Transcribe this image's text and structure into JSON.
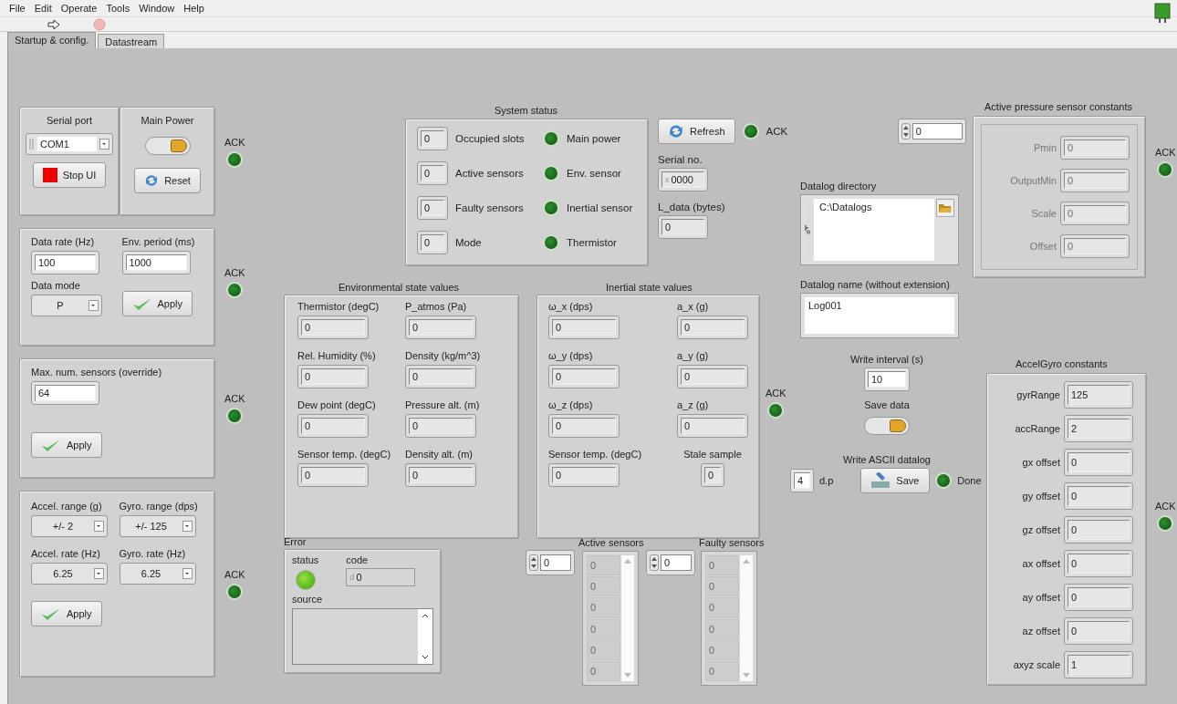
{
  "menu": [
    "File",
    "Edit",
    "Operate",
    "Tools",
    "Window",
    "Help"
  ],
  "tabs": [
    {
      "label": "Startup & config.",
      "selected": true
    },
    {
      "label": "Datastream",
      "selected": false
    }
  ],
  "connection": {
    "serial_port": {
      "label": "Serial port",
      "value": "COM1"
    },
    "stop_button": "Stop UI",
    "main_power": {
      "label": "Main Power",
      "on": true
    },
    "reset_button": "Reset",
    "ack": {
      "label": "ACK",
      "on": false
    }
  },
  "rates": {
    "data_rate": {
      "label": "Data rate (Hz)",
      "value": "100"
    },
    "env_period": {
      "label": "Env. period (ms)",
      "value": "1000"
    },
    "data_mode": {
      "label": "Data mode",
      "value": "P"
    },
    "apply_button": "Apply",
    "ack": {
      "label": "ACK",
      "on": false
    }
  },
  "sensor_override": {
    "label": "Max. num. sensors (override)",
    "value": "64",
    "apply_button": "Apply",
    "ack": {
      "label": "ACK",
      "on": false
    }
  },
  "imu_config": {
    "fields": [
      {
        "label": "Accel. range (g)",
        "value": "+/- 2"
      },
      {
        "label": "Gyro. range (dps)",
        "value": "+/- 125"
      },
      {
        "label": "Accel. rate (Hz)",
        "value": "6.25"
      },
      {
        "label": "Gyro. rate (Hz)",
        "value": "6.25"
      }
    ],
    "apply_button": "Apply",
    "ack": {
      "label": "ACK",
      "on": false
    }
  },
  "system_status": {
    "title": "System status",
    "counts": [
      {
        "label": "Occupied slots",
        "value": "0"
      },
      {
        "label": "Active sensors",
        "value": "0"
      },
      {
        "label": "Faulty sensors",
        "value": "0"
      },
      {
        "label": "Mode",
        "value": "0"
      }
    ],
    "leds": [
      {
        "label": "Main power",
        "on": false
      },
      {
        "label": "Env. sensor",
        "on": false
      },
      {
        "label": "Inertial sensor",
        "on": false
      },
      {
        "label": "Thermistor",
        "on": false
      }
    ],
    "refresh_button": "Refresh",
    "ack": {
      "label": "ACK",
      "on": false
    },
    "serial_no": {
      "label": "Serial no.",
      "radix": "x",
      "value": "0000"
    },
    "l_data": {
      "label": "L_data (bytes)",
      "value": "0"
    }
  },
  "environmental": {
    "title": "Environmental state values",
    "fields": [
      {
        "label": "Thermistor (degC)",
        "value": "0"
      },
      {
        "label": "P_atmos (Pa)",
        "value": "0"
      },
      {
        "label": "Rel. Humidity (%)",
        "value": "0"
      },
      {
        "label": "Density (kg/m^3)",
        "value": "0"
      },
      {
        "label": "Dew point (degC)",
        "value": "0"
      },
      {
        "label": "Pressure alt. (m)",
        "value": "0"
      },
      {
        "label": "Sensor temp. (degC)",
        "value": "0"
      },
      {
        "label": "Density alt. (m)",
        "value": "0"
      }
    ]
  },
  "inertial": {
    "title": "Inertial state values",
    "fields": [
      {
        "kind": "numeric",
        "label": "ω_x (dps)",
        "value": "0"
      },
      {
        "kind": "numeric",
        "label": "a_x (g)",
        "value": "0"
      },
      {
        "kind": "numeric",
        "label": "ω_y (dps)",
        "value": "0"
      },
      {
        "kind": "numeric",
        "label": "a_y (g)",
        "value": "0"
      },
      {
        "kind": "numeric",
        "label": "ω_z (dps)",
        "value": "0"
      },
      {
        "kind": "numeric",
        "label": "a_z (g)",
        "value": "0"
      },
      {
        "kind": "numeric",
        "label": "Sensor temp. (degC)",
        "value": "0"
      },
      {
        "kind": "small",
        "label": "Stale sample",
        "value": "0"
      }
    ],
    "ack": {
      "label": "ACK",
      "on": false
    }
  },
  "error": {
    "title": "Error",
    "status": {
      "label": "status",
      "ok": true
    },
    "code": {
      "label": "code",
      "radix": "d",
      "value": "0"
    },
    "source": {
      "label": "source"
    }
  },
  "active_sensors": {
    "label": "Active sensors",
    "index": "0",
    "items": [
      "0",
      "0",
      "0",
      "0",
      "0",
      "0"
    ]
  },
  "faulty_sensors": {
    "label": "Faulty sensors",
    "index": "0",
    "items": [
      "0",
      "0",
      "0",
      "0",
      "0",
      "0"
    ]
  },
  "datalog": {
    "directory": {
      "label": "Datalog directory",
      "value": "C:\\Datalogs"
    },
    "name": {
      "label": "Datalog name (without extension)",
      "value": "Log001"
    },
    "write_interval": {
      "label": "Write interval (s)",
      "value": "10"
    },
    "save_data": {
      "label": "Save data",
      "on": true
    },
    "ascii": {
      "label": "Write ASCII datalog",
      "decimals": "4",
      "decimals_label": "d.p",
      "save_button": "Save",
      "done": {
        "label": "Done",
        "on": false
      }
    }
  },
  "pressure": {
    "index": "0",
    "title": "Active pressure sensor constants",
    "disabled": true,
    "fields": [
      {
        "label": "Pmin",
        "value": "0"
      },
      {
        "label": "OutputMin",
        "value": "0"
      },
      {
        "label": "Scale",
        "value": "0"
      },
      {
        "label": "Offset",
        "value": "0"
      }
    ],
    "ack": {
      "label": "ACK",
      "on": false
    }
  },
  "accelgyro": {
    "title": "AccelGyro constants",
    "fields": [
      {
        "label": "gyrRange",
        "value": "125"
      },
      {
        "label": "accRange",
        "value": "2"
      },
      {
        "label": "gx offset",
        "value": "0"
      },
      {
        "label": "gy offset",
        "value": "0"
      },
      {
        "label": "gz offset",
        "value": "0"
      },
      {
        "label": "ax offset",
        "value": "0"
      },
      {
        "label": "ay offset",
        "value": "0"
      },
      {
        "label": "az offset",
        "value": "0"
      },
      {
        "label": "axyz scale",
        "value": "1"
      }
    ],
    "ack": {
      "label": "ACK",
      "on": false
    }
  }
}
